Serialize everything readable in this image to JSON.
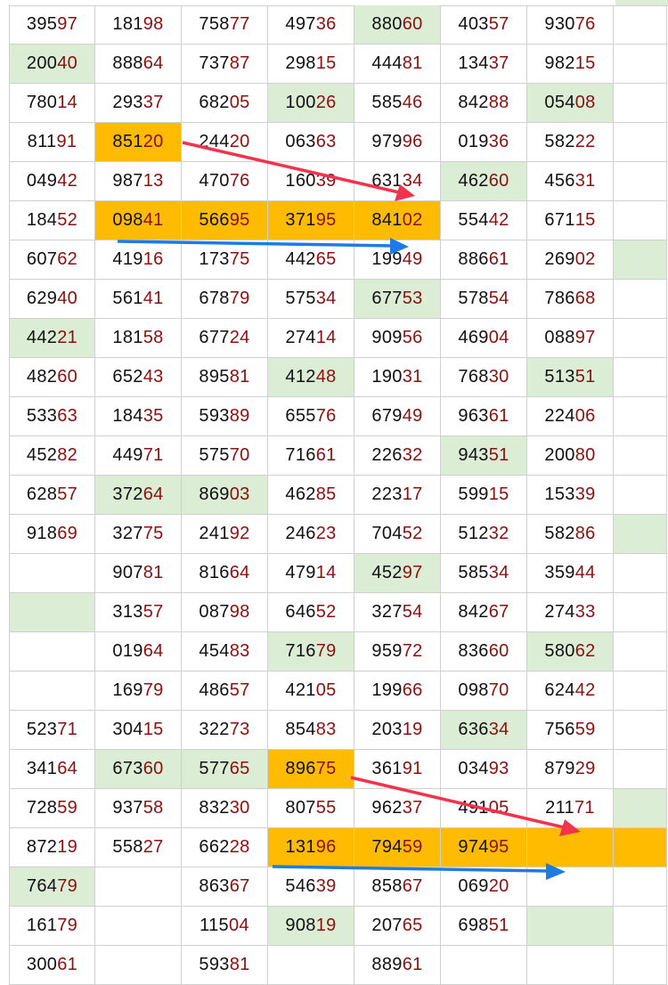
{
  "sheet": {
    "rows": [
      [
        {
          "v": "39597"
        },
        {
          "v": "18198"
        },
        {
          "v": "75877"
        },
        {
          "v": "49736"
        },
        {
          "v": "88060",
          "hl": "green"
        },
        {
          "v": "40357"
        },
        {
          "v": "93076"
        },
        {
          "v": ""
        }
      ],
      [
        {
          "v": "20040",
          "hl": "green"
        },
        {
          "v": "88864"
        },
        {
          "v": "73787"
        },
        {
          "v": "29815"
        },
        {
          "v": "44481"
        },
        {
          "v": "13437"
        },
        {
          "v": "98215"
        },
        {
          "v": ""
        }
      ],
      [
        {
          "v": "78014"
        },
        {
          "v": "29337"
        },
        {
          "v": "68205"
        },
        {
          "v": "10026",
          "hl": "green"
        },
        {
          "v": "58546"
        },
        {
          "v": "84288"
        },
        {
          "v": "05408",
          "hl": "green"
        },
        {
          "v": ""
        }
      ],
      [
        {
          "v": "81191"
        },
        {
          "v": "85120",
          "hl": "orange"
        },
        {
          "v": "24420"
        },
        {
          "v": "06363"
        },
        {
          "v": "97996"
        },
        {
          "v": "01936"
        },
        {
          "v": "58222"
        },
        {
          "v": ""
        }
      ],
      [
        {
          "v": "04942"
        },
        {
          "v": "98713"
        },
        {
          "v": "47076"
        },
        {
          "v": "16039"
        },
        {
          "v": "63134"
        },
        {
          "v": "46260",
          "hl": "green"
        },
        {
          "v": "45631"
        },
        {
          "v": ""
        }
      ],
      [
        {
          "v": "18452"
        },
        {
          "v": "09841",
          "hl": "orange"
        },
        {
          "v": "56695",
          "hl": "orange"
        },
        {
          "v": "37195",
          "hl": "orange"
        },
        {
          "v": "84102",
          "hl": "orange"
        },
        {
          "v": "55442"
        },
        {
          "v": "67115"
        },
        {
          "v": ""
        }
      ],
      [
        {
          "v": "60762"
        },
        {
          "v": "41916"
        },
        {
          "v": "17375"
        },
        {
          "v": "44265"
        },
        {
          "v": "19949"
        },
        {
          "v": "88661"
        },
        {
          "v": "26902"
        },
        {
          "v": "",
          "hl": "green"
        }
      ],
      [
        {
          "v": "62940"
        },
        {
          "v": "56141"
        },
        {
          "v": "67879"
        },
        {
          "v": "57534"
        },
        {
          "v": "67753",
          "hl": "green"
        },
        {
          "v": "57854"
        },
        {
          "v": "78668"
        },
        {
          "v": ""
        }
      ],
      [
        {
          "v": "44221",
          "hl": "green"
        },
        {
          "v": "18158"
        },
        {
          "v": "67724"
        },
        {
          "v": "27414"
        },
        {
          "v": "90956"
        },
        {
          "v": "46904"
        },
        {
          "v": "08897"
        },
        {
          "v": ""
        }
      ],
      [
        {
          "v": "48260"
        },
        {
          "v": "65243"
        },
        {
          "v": "89581"
        },
        {
          "v": "41248",
          "hl": "green"
        },
        {
          "v": "19031"
        },
        {
          "v": "76830"
        },
        {
          "v": "51351",
          "hl": "green"
        },
        {
          "v": ""
        }
      ],
      [
        {
          "v": "53363"
        },
        {
          "v": "18435"
        },
        {
          "v": "59389"
        },
        {
          "v": "65576"
        },
        {
          "v": "67949"
        },
        {
          "v": "96361"
        },
        {
          "v": "22406"
        },
        {
          "v": ""
        }
      ],
      [
        {
          "v": "45282"
        },
        {
          "v": "44971"
        },
        {
          "v": "57570"
        },
        {
          "v": "71661"
        },
        {
          "v": "22632"
        },
        {
          "v": "94351",
          "hl": "green"
        },
        {
          "v": "20080"
        },
        {
          "v": ""
        }
      ],
      [
        {
          "v": "62857"
        },
        {
          "v": "37264",
          "hl": "green"
        },
        {
          "v": "86903",
          "hl": "green"
        },
        {
          "v": "46285"
        },
        {
          "v": "22317"
        },
        {
          "v": "59915"
        },
        {
          "v": "15339"
        },
        {
          "v": ""
        }
      ],
      [
        {
          "v": "91869"
        },
        {
          "v": "32775"
        },
        {
          "v": "24192"
        },
        {
          "v": "24623"
        },
        {
          "v": "70452"
        },
        {
          "v": "51232"
        },
        {
          "v": "58286"
        },
        {
          "v": "",
          "hl": "green"
        }
      ],
      [
        {
          "v": ""
        },
        {
          "v": "90781"
        },
        {
          "v": "81664"
        },
        {
          "v": "47914"
        },
        {
          "v": "45297",
          "hl": "green"
        },
        {
          "v": "58534"
        },
        {
          "v": "35944"
        },
        {
          "v": ""
        }
      ],
      [
        {
          "v": "",
          "hl": "green"
        },
        {
          "v": "31357"
        },
        {
          "v": "08798"
        },
        {
          "v": "64652"
        },
        {
          "v": "32754"
        },
        {
          "v": "84267"
        },
        {
          "v": "27433"
        },
        {
          "v": ""
        }
      ],
      [
        {
          "v": ""
        },
        {
          "v": "01964"
        },
        {
          "v": "45483"
        },
        {
          "v": "71679",
          "hl": "green"
        },
        {
          "v": "95972"
        },
        {
          "v": "83660"
        },
        {
          "v": "58062",
          "hl": "green"
        },
        {
          "v": ""
        }
      ],
      [
        {
          "v": ""
        },
        {
          "v": "16979"
        },
        {
          "v": "48657"
        },
        {
          "v": "42105"
        },
        {
          "v": "19966"
        },
        {
          "v": "09870"
        },
        {
          "v": "62442"
        },
        {
          "v": ""
        }
      ],
      [
        {
          "v": "52371"
        },
        {
          "v": "30415"
        },
        {
          "v": "32273"
        },
        {
          "v": "85483"
        },
        {
          "v": "20319"
        },
        {
          "v": "63634",
          "hl": "green"
        },
        {
          "v": "75659"
        },
        {
          "v": ""
        }
      ],
      [
        {
          "v": "34164"
        },
        {
          "v": "67360",
          "hl": "green"
        },
        {
          "v": "57765",
          "hl": "green"
        },
        {
          "v": "89675",
          "hl": "orange"
        },
        {
          "v": "36191"
        },
        {
          "v": "03493"
        },
        {
          "v": "87929"
        },
        {
          "v": ""
        }
      ],
      [
        {
          "v": "72859"
        },
        {
          "v": "93758"
        },
        {
          "v": "83230"
        },
        {
          "v": "80755"
        },
        {
          "v": "96237"
        },
        {
          "v": "49105"
        },
        {
          "v": "21171"
        },
        {
          "v": "",
          "hl": "green"
        }
      ],
      [
        {
          "v": "87219"
        },
        {
          "v": "55827"
        },
        {
          "v": "66228"
        },
        {
          "v": "13196",
          "hl": "orange"
        },
        {
          "v": "79459",
          "hl": "orange"
        },
        {
          "v": "97495",
          "hl": "orange"
        },
        {
          "v": "",
          "hl": "orange"
        },
        {
          "v": "",
          "hl": "orange"
        }
      ],
      [
        {
          "v": "76479",
          "hl": "green"
        },
        {
          "v": ""
        },
        {
          "v": "86367"
        },
        {
          "v": "54639"
        },
        {
          "v": "85867"
        },
        {
          "v": "06920"
        },
        {
          "v": ""
        },
        {
          "v": ""
        }
      ],
      [
        {
          "v": "16179"
        },
        {
          "v": ""
        },
        {
          "v": "11504"
        },
        {
          "v": "90819",
          "hl": "green"
        },
        {
          "v": "20765"
        },
        {
          "v": "69851"
        },
        {
          "v": "",
          "hl": "green"
        },
        {
          "v": ""
        }
      ],
      [
        {
          "v": "30061"
        },
        {
          "v": ""
        },
        {
          "v": "59381"
        },
        {
          "v": ""
        },
        {
          "v": "88961"
        },
        {
          "v": ""
        },
        {
          "v": ""
        },
        {
          "v": ""
        }
      ]
    ]
  },
  "colors": {
    "green": "#dcedd6",
    "orange": "#ffbb00",
    "tail_digits": "#8b1010",
    "arrow_red": "#f0344e",
    "arrow_blue": "#1e7be6"
  },
  "annotations": {
    "arrows": [
      {
        "name": "red-arrow-1",
        "color": "red"
      },
      {
        "name": "blue-arrow-1",
        "color": "blue"
      },
      {
        "name": "red-arrow-2",
        "color": "red"
      },
      {
        "name": "blue-arrow-2",
        "color": "blue"
      }
    ]
  }
}
